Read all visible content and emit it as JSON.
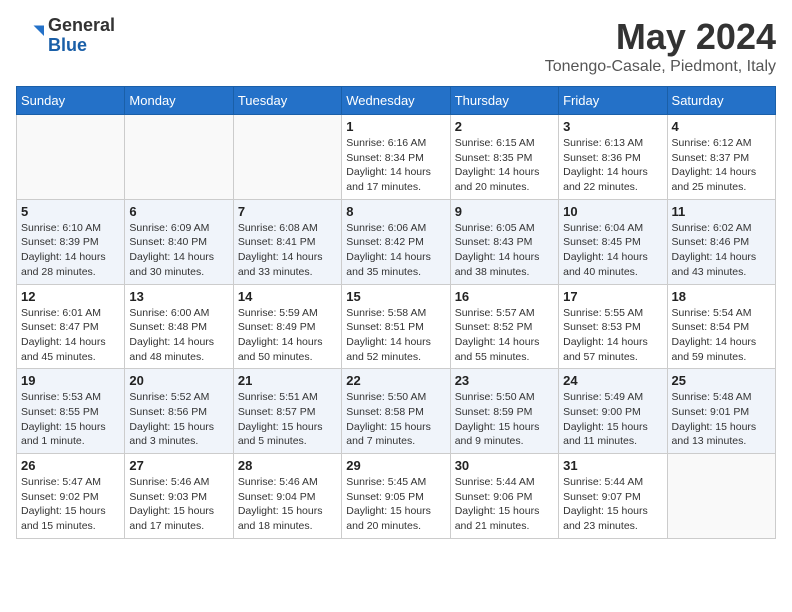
{
  "header": {
    "logo_general": "General",
    "logo_blue": "Blue",
    "month_year": "May 2024",
    "location": "Tonengo-Casale, Piedmont, Italy"
  },
  "weekdays": [
    "Sunday",
    "Monday",
    "Tuesday",
    "Wednesday",
    "Thursday",
    "Friday",
    "Saturday"
  ],
  "weeks": [
    [
      {
        "day": "",
        "info": ""
      },
      {
        "day": "",
        "info": ""
      },
      {
        "day": "",
        "info": ""
      },
      {
        "day": "1",
        "info": "Sunrise: 6:16 AM\nSunset: 8:34 PM\nDaylight: 14 hours\nand 17 minutes."
      },
      {
        "day": "2",
        "info": "Sunrise: 6:15 AM\nSunset: 8:35 PM\nDaylight: 14 hours\nand 20 minutes."
      },
      {
        "day": "3",
        "info": "Sunrise: 6:13 AM\nSunset: 8:36 PM\nDaylight: 14 hours\nand 22 minutes."
      },
      {
        "day": "4",
        "info": "Sunrise: 6:12 AM\nSunset: 8:37 PM\nDaylight: 14 hours\nand 25 minutes."
      }
    ],
    [
      {
        "day": "5",
        "info": "Sunrise: 6:10 AM\nSunset: 8:39 PM\nDaylight: 14 hours\nand 28 minutes."
      },
      {
        "day": "6",
        "info": "Sunrise: 6:09 AM\nSunset: 8:40 PM\nDaylight: 14 hours\nand 30 minutes."
      },
      {
        "day": "7",
        "info": "Sunrise: 6:08 AM\nSunset: 8:41 PM\nDaylight: 14 hours\nand 33 minutes."
      },
      {
        "day": "8",
        "info": "Sunrise: 6:06 AM\nSunset: 8:42 PM\nDaylight: 14 hours\nand 35 minutes."
      },
      {
        "day": "9",
        "info": "Sunrise: 6:05 AM\nSunset: 8:43 PM\nDaylight: 14 hours\nand 38 minutes."
      },
      {
        "day": "10",
        "info": "Sunrise: 6:04 AM\nSunset: 8:45 PM\nDaylight: 14 hours\nand 40 minutes."
      },
      {
        "day": "11",
        "info": "Sunrise: 6:02 AM\nSunset: 8:46 PM\nDaylight: 14 hours\nand 43 minutes."
      }
    ],
    [
      {
        "day": "12",
        "info": "Sunrise: 6:01 AM\nSunset: 8:47 PM\nDaylight: 14 hours\nand 45 minutes."
      },
      {
        "day": "13",
        "info": "Sunrise: 6:00 AM\nSunset: 8:48 PM\nDaylight: 14 hours\nand 48 minutes."
      },
      {
        "day": "14",
        "info": "Sunrise: 5:59 AM\nSunset: 8:49 PM\nDaylight: 14 hours\nand 50 minutes."
      },
      {
        "day": "15",
        "info": "Sunrise: 5:58 AM\nSunset: 8:51 PM\nDaylight: 14 hours\nand 52 minutes."
      },
      {
        "day": "16",
        "info": "Sunrise: 5:57 AM\nSunset: 8:52 PM\nDaylight: 14 hours\nand 55 minutes."
      },
      {
        "day": "17",
        "info": "Sunrise: 5:55 AM\nSunset: 8:53 PM\nDaylight: 14 hours\nand 57 minutes."
      },
      {
        "day": "18",
        "info": "Sunrise: 5:54 AM\nSunset: 8:54 PM\nDaylight: 14 hours\nand 59 minutes."
      }
    ],
    [
      {
        "day": "19",
        "info": "Sunrise: 5:53 AM\nSunset: 8:55 PM\nDaylight: 15 hours\nand 1 minute."
      },
      {
        "day": "20",
        "info": "Sunrise: 5:52 AM\nSunset: 8:56 PM\nDaylight: 15 hours\nand 3 minutes."
      },
      {
        "day": "21",
        "info": "Sunrise: 5:51 AM\nSunset: 8:57 PM\nDaylight: 15 hours\nand 5 minutes."
      },
      {
        "day": "22",
        "info": "Sunrise: 5:50 AM\nSunset: 8:58 PM\nDaylight: 15 hours\nand 7 minutes."
      },
      {
        "day": "23",
        "info": "Sunrise: 5:50 AM\nSunset: 8:59 PM\nDaylight: 15 hours\nand 9 minutes."
      },
      {
        "day": "24",
        "info": "Sunrise: 5:49 AM\nSunset: 9:00 PM\nDaylight: 15 hours\nand 11 minutes."
      },
      {
        "day": "25",
        "info": "Sunrise: 5:48 AM\nSunset: 9:01 PM\nDaylight: 15 hours\nand 13 minutes."
      }
    ],
    [
      {
        "day": "26",
        "info": "Sunrise: 5:47 AM\nSunset: 9:02 PM\nDaylight: 15 hours\nand 15 minutes."
      },
      {
        "day": "27",
        "info": "Sunrise: 5:46 AM\nSunset: 9:03 PM\nDaylight: 15 hours\nand 17 minutes."
      },
      {
        "day": "28",
        "info": "Sunrise: 5:46 AM\nSunset: 9:04 PM\nDaylight: 15 hours\nand 18 minutes."
      },
      {
        "day": "29",
        "info": "Sunrise: 5:45 AM\nSunset: 9:05 PM\nDaylight: 15 hours\nand 20 minutes."
      },
      {
        "day": "30",
        "info": "Sunrise: 5:44 AM\nSunset: 9:06 PM\nDaylight: 15 hours\nand 21 minutes."
      },
      {
        "day": "31",
        "info": "Sunrise: 5:44 AM\nSunset: 9:07 PM\nDaylight: 15 hours\nand 23 minutes."
      },
      {
        "day": "",
        "info": ""
      }
    ]
  ]
}
